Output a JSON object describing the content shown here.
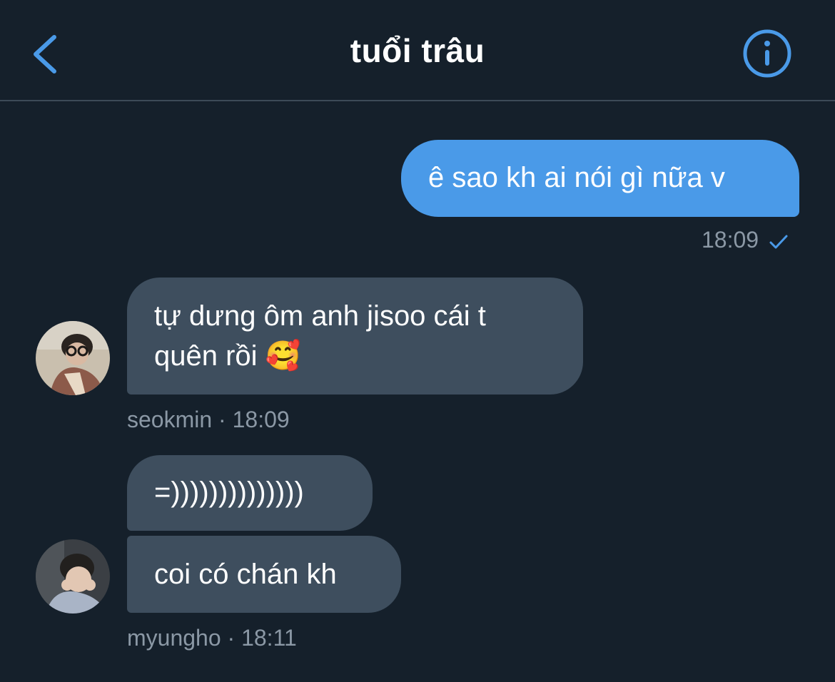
{
  "header": {
    "title": "tuổi trâu",
    "back_icon": "chevron-left-icon",
    "info_icon": "info-circle-icon",
    "accent": "#4a9ae8"
  },
  "messages": [
    {
      "direction": "outgoing",
      "text": "ê sao kh ai nói gì nữa v",
      "time": "18:09",
      "status_icon": "checkmark-icon"
    },
    {
      "direction": "incoming",
      "lines": [
        "tự dưng ôm anh jisoo cái t",
        "quên rồi 🥰"
      ],
      "sender": "seokmin",
      "separator": "·",
      "time": "18:09"
    },
    {
      "direction": "incoming",
      "text": "=))))))))))))))"
    },
    {
      "direction": "incoming",
      "text": "coi có chán kh",
      "sender": "myungho",
      "separator": "·",
      "time": "18:11"
    }
  ],
  "colors": {
    "background": "#15202b",
    "outgoing_bubble": "#4a9ae8",
    "incoming_bubble": "#3e4e5e",
    "meta_text": "#8b98a5"
  }
}
